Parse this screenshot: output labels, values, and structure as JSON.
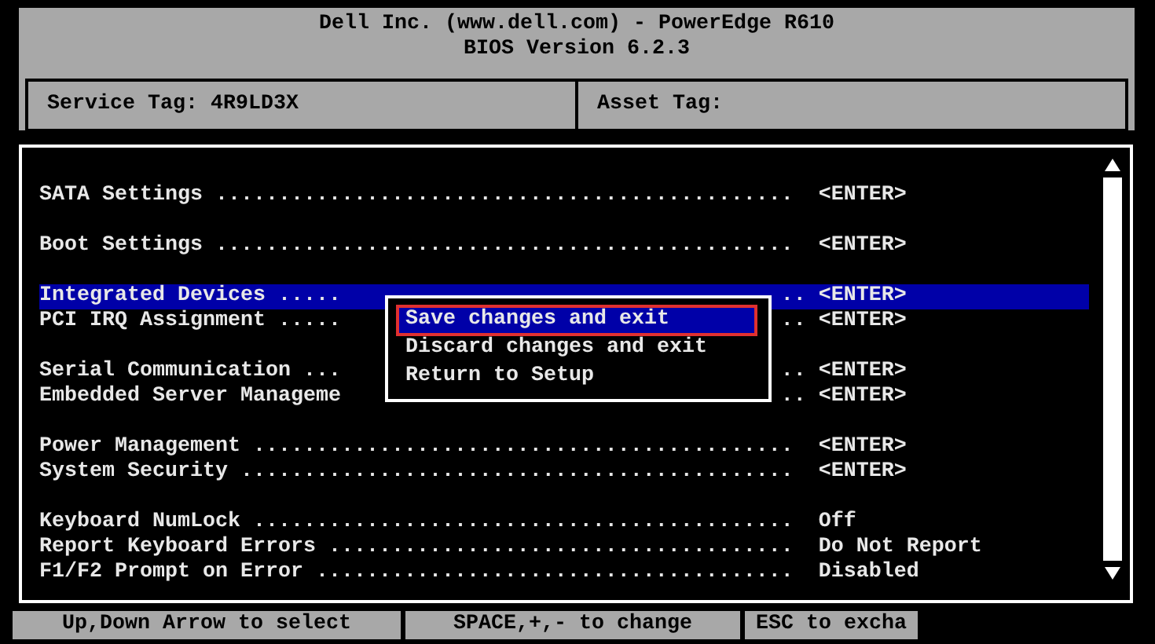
{
  "header": {
    "title_lines": [
      "Dell Inc. (www.dell.com) - PowerEdge R610",
      "BIOS Version 6.2.3"
    ],
    "fields": [
      {
        "label": "Service Tag: 4R9LD3X"
      },
      {
        "label": "Asset Tag:"
      }
    ]
  },
  "menu": {
    "groups": [
      [
        {
          "label": "SATA Settings ..............................................",
          "value": "<ENTER>",
          "selected": false
        }
      ],
      [
        {
          "label": "Boot Settings ..............................................",
          "value": "<ENTER>",
          "selected": false
        }
      ],
      [
        {
          "label": "Integrated Devices .....",
          "tail": "..",
          "value": "<ENTER>",
          "selected": true
        },
        {
          "label": "PCI IRQ Assignment .....",
          "tail": "..",
          "value": "<ENTER>",
          "selected": false
        }
      ],
      [
        {
          "label": "Serial Communication ...",
          "tail": "..",
          "value": "<ENTER>",
          "selected": false
        },
        {
          "label": "Embedded Server Manageme",
          "tail": "..",
          "value": "<ENTER>",
          "selected": false
        }
      ],
      [
        {
          "label": "Power Management ...........................................",
          "value": "<ENTER>",
          "selected": false
        },
        {
          "label": "System Security ............................................",
          "value": "<ENTER>",
          "selected": false
        }
      ],
      [
        {
          "label": "Keyboard NumLock ...........................................",
          "value": "Off",
          "selected": false
        },
        {
          "label": "Report Keyboard Errors .....................................",
          "value": "Do Not Report",
          "selected": false
        },
        {
          "label": "F1/F2 Prompt on Error ......................................",
          "value": "Disabled",
          "selected": false
        }
      ]
    ]
  },
  "dialog": {
    "options": [
      {
        "label": "Save changes and exit",
        "selected": true,
        "outlined": true
      },
      {
        "label": "Discard changes and exit",
        "selected": false,
        "outlined": false
      },
      {
        "label": "Return to Setup",
        "selected": false,
        "outlined": false
      }
    ]
  },
  "status_bar": [
    "Up,Down Arrow to select",
    "SPACE,+,- to change",
    "ESC to excha"
  ]
}
